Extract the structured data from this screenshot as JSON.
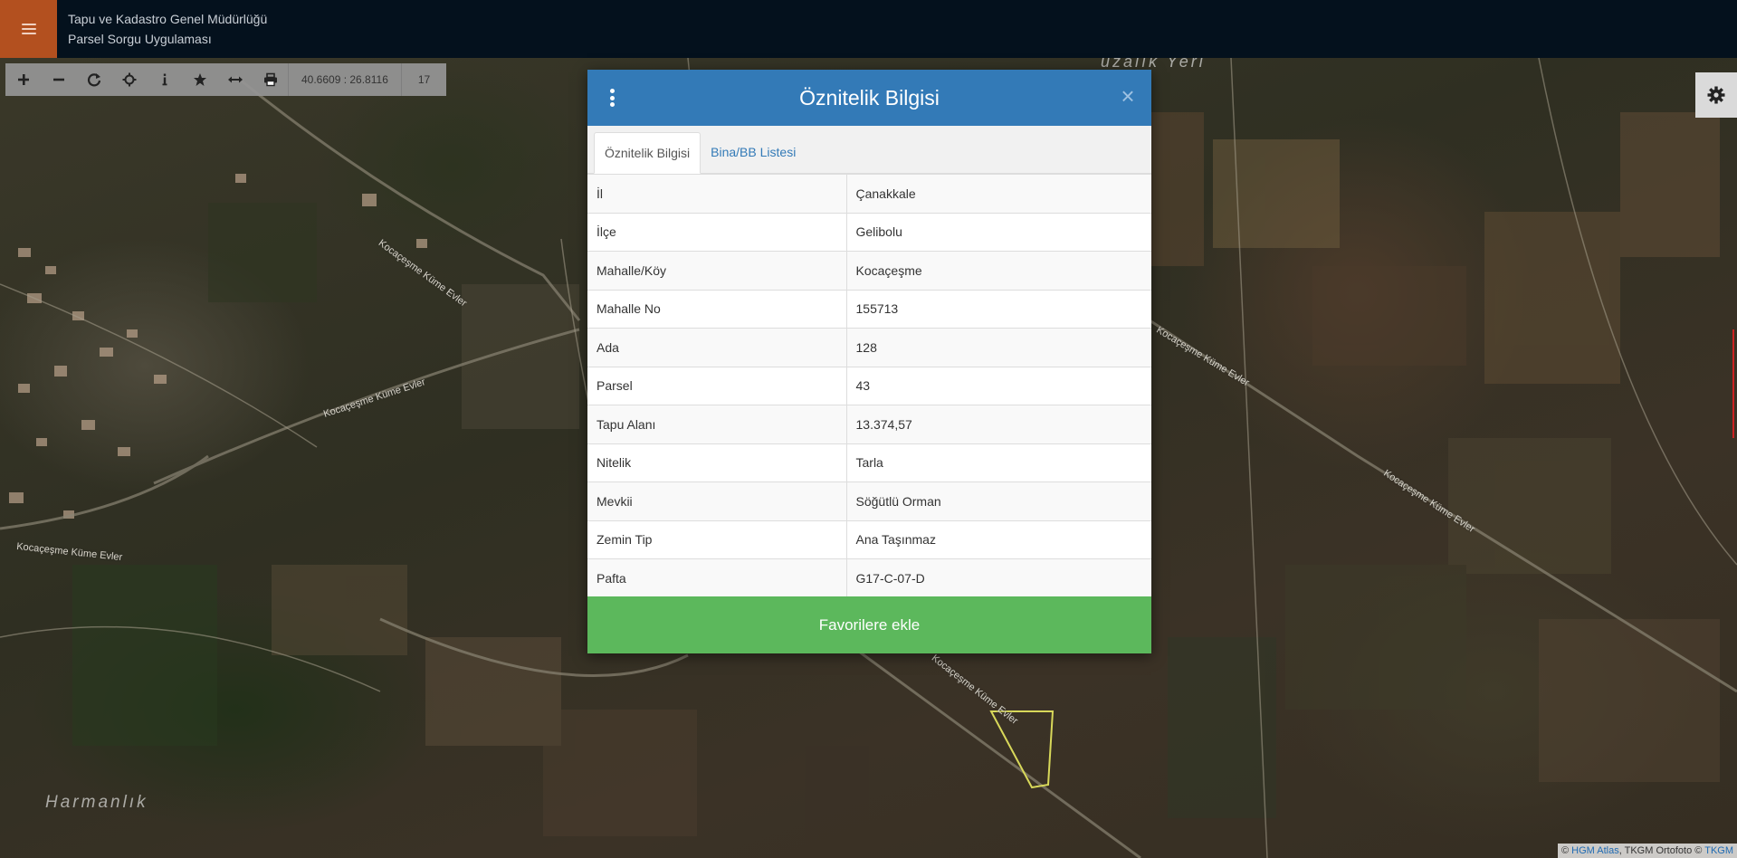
{
  "header": {
    "title_line1": "Tapu ve Kadastro Genel Müdürlüğü",
    "title_line2": "Parsel Sorgu Uygulaması"
  },
  "toolbar": {
    "buttons": [
      "zoom-in-icon",
      "zoom-out-icon",
      "refresh-icon",
      "locate-icon",
      "info-icon",
      "star-icon",
      "measure-icon",
      "print-icon"
    ],
    "coordinates": "40.6609 : 26.8116",
    "zoom_level": "17"
  },
  "map": {
    "labels": {
      "road_1": "Kocaçeşme Küme Evler",
      "road_2": "Kocaçeşme Küme Evler",
      "road_3": "Kocaçeşme Küme Evler",
      "road_4": "Kocaçeşme Küme Evler",
      "road_5": "Kocaçeşme Küme Evler",
      "road_6": "Kocaçeşme Küme Evler",
      "place_1": "Harmanlık",
      "place_2": "uzalık Yeri"
    },
    "attribution": {
      "prefix": "©",
      "hgm": "HGM Atlas",
      "middle": ", TKGM Ortofoto ©",
      "tkgm": "TKGM"
    }
  },
  "modal": {
    "title": "Öznitelik Bilgisi",
    "close": "×",
    "tabs": [
      "Öznitelik Bilgisi",
      "Bina/BB Listesi"
    ],
    "rows": [
      {
        "key": "İl",
        "value": "Çanakkale"
      },
      {
        "key": "İlçe",
        "value": "Gelibolu"
      },
      {
        "key": "Mahalle/Köy",
        "value": "Kocaçeşme"
      },
      {
        "key": "Mahalle No",
        "value": "155713"
      },
      {
        "key": "Ada",
        "value": "128"
      },
      {
        "key": "Parsel",
        "value": "43"
      },
      {
        "key": "Tapu Alanı",
        "value": "13.374,57"
      },
      {
        "key": "Nitelik",
        "value": "Tarla"
      },
      {
        "key": "Mevkii",
        "value": "Söğütlü Orman"
      },
      {
        "key": "Zemin Tip",
        "value": "Ana Taşınmaz"
      },
      {
        "key": "Pafta",
        "value": "G17-C-07-D"
      }
    ],
    "favorite_button": "Favorilere ekle"
  },
  "colors": {
    "header_bg": "#04111d",
    "menu_accent": "#b3501f",
    "modal_header": "#337ab7",
    "favorite_green": "#5cb85c"
  }
}
